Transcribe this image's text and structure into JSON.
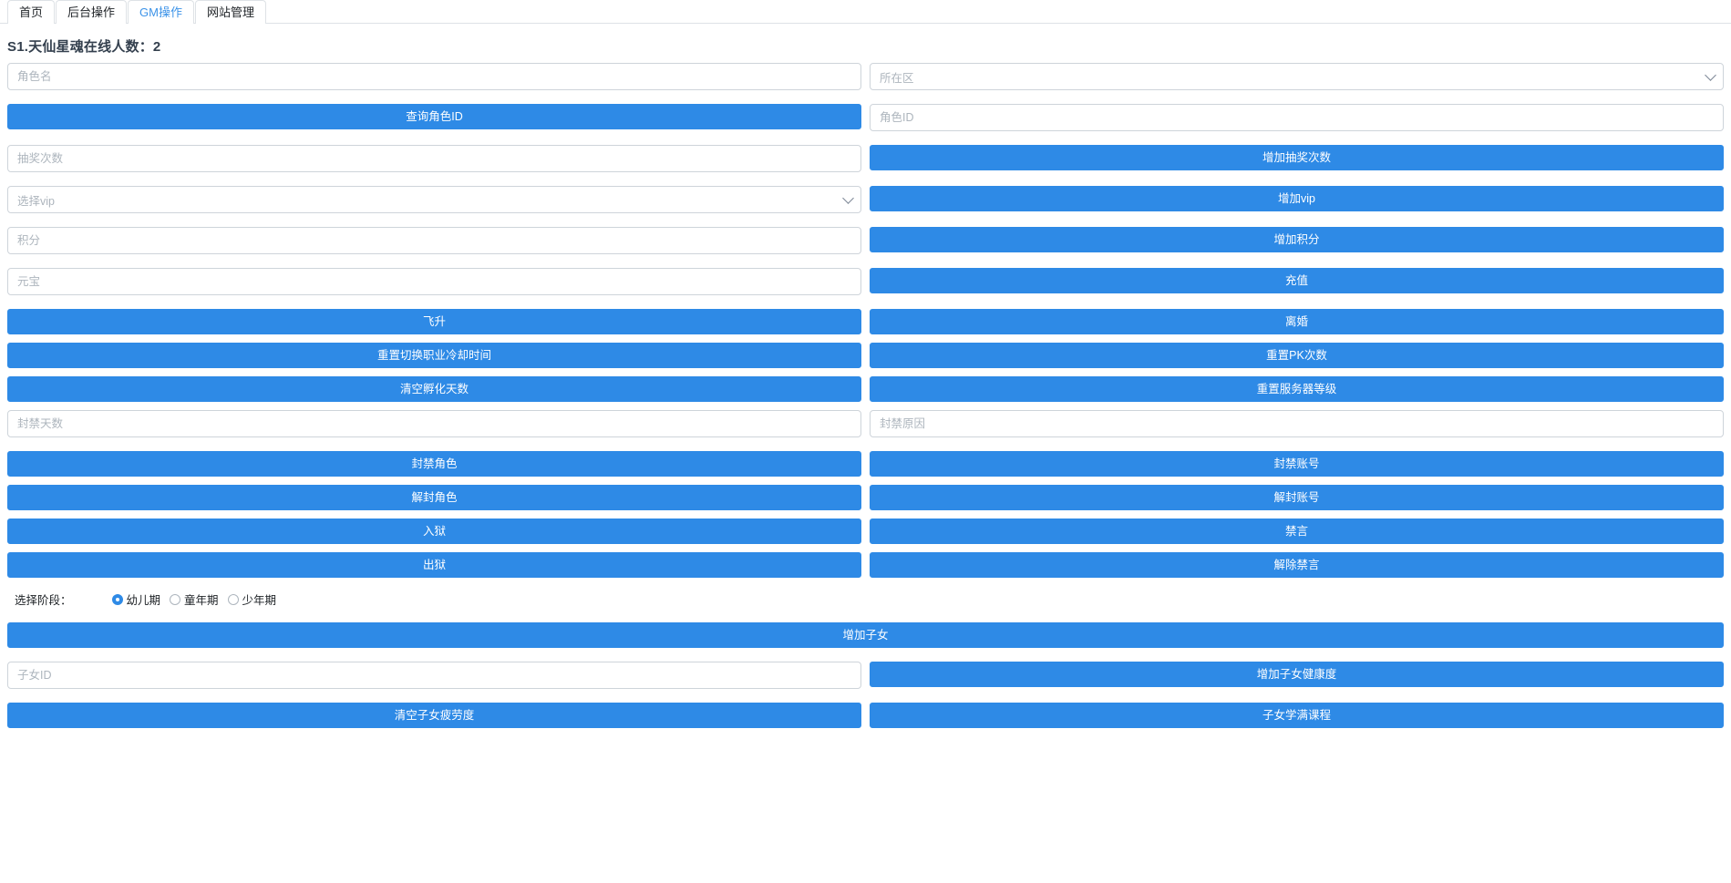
{
  "tabs": [
    {
      "label": "首页",
      "active": false
    },
    {
      "label": "后台操作",
      "active": false
    },
    {
      "label": "GM操作",
      "active": true
    },
    {
      "label": "网站管理",
      "active": false
    }
  ],
  "page": {
    "title": "S1.天仙星魂在线人数：2"
  },
  "colors": {
    "primary": "#2e8ae6",
    "active_tab_text": "#3c93e8",
    "border": "#ced4da",
    "placeholder": "#adb5bd"
  },
  "icons": {
    "chevron_down": "chevron-down-icon",
    "radio": "radio-icon"
  },
  "form": {
    "role_name": {
      "placeholder": "角色名",
      "value": ""
    },
    "zone_select": {
      "placeholder": "所在区",
      "value": ""
    },
    "query_role_id_button": "查询角色ID",
    "role_id": {
      "placeholder": "角色ID",
      "value": ""
    },
    "draw_count": {
      "placeholder": "抽奖次数",
      "value": ""
    },
    "add_draw_count_button": "增加抽奖次数",
    "vip_select": {
      "placeholder": "选择vip",
      "value": ""
    },
    "add_vip_button": "增加vip",
    "points": {
      "placeholder": "积分",
      "value": ""
    },
    "add_points_button": "增加积分",
    "ingot": {
      "placeholder": "元宝",
      "value": ""
    },
    "recharge_button": "充值",
    "ascend_button": "飞升",
    "divorce_button": "离婚",
    "reset_job_cooldown_button": "重置切换职业冷却时间",
    "reset_pk_count_button": "重置PK次数",
    "clear_hatch_days_button": "清空孵化天数",
    "reset_server_level_button": "重置服务器等级",
    "ban_days": {
      "placeholder": "封禁天数",
      "value": ""
    },
    "ban_reason": {
      "placeholder": "封禁原因",
      "value": ""
    },
    "ban_role_button": "封禁角色",
    "ban_account_button": "封禁账号",
    "unban_role_button": "解封角色",
    "unban_account_button": "解封账号",
    "jail_button": "入狱",
    "mute_button": "禁言",
    "release_jail_button": "出狱",
    "unmute_button": "解除禁言"
  },
  "stage": {
    "label": "选择阶段：",
    "options": [
      {
        "label": "幼儿期",
        "checked": true
      },
      {
        "label": "童年期",
        "checked": false
      },
      {
        "label": "少年期",
        "checked": false
      }
    ]
  },
  "child": {
    "add_child_button": "增加子女",
    "child_id": {
      "placeholder": "子女ID",
      "value": ""
    },
    "add_child_health_button": "增加子女健康度",
    "clear_child_fatigue_button": "清空子女疲劳度",
    "child_finish_course_button": "子女学满课程"
  }
}
